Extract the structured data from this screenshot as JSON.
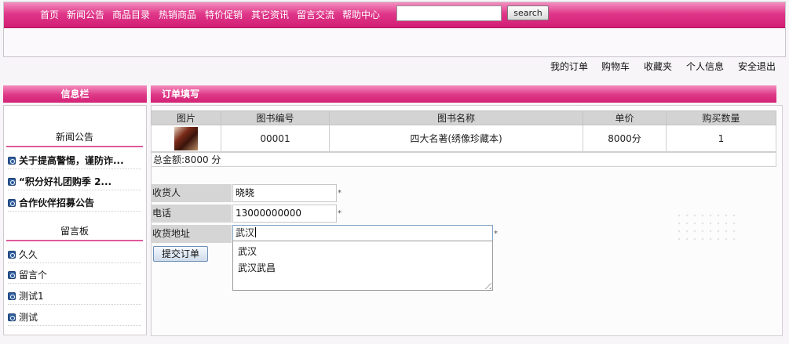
{
  "nav": {
    "items": [
      "首页",
      "新闻公告",
      "商品目录",
      "热销商品",
      "特价促销",
      "其它资讯",
      "留言交流",
      "帮助中心"
    ],
    "search_placeholder": "",
    "search_label": "search"
  },
  "user_links": [
    "我的订单",
    "购物车",
    "收藏夹",
    "个人信息",
    "安全退出"
  ],
  "sidebar": {
    "title": "信息栏",
    "news_title": "新闻公告",
    "news_items": [
      "关于提高警惕，谨防诈...",
      "“积分好礼团购季 2...",
      "合作伙伴招募公告"
    ],
    "messages_title": "留言板",
    "message_items": [
      "久久",
      "留言个",
      "测试1",
      "测试"
    ]
  },
  "main": {
    "title": "订单填写",
    "table": {
      "headers": [
        "图片",
        "图书编号",
        "图书名称",
        "单价",
        "购买数量"
      ],
      "rows": [
        {
          "id": "00001",
          "name": "四大名著(绣像珍藏本)",
          "price": "8000分",
          "qty": "1"
        }
      ]
    },
    "total": "总金额:8000 分",
    "form": {
      "receiver_label": "收货人",
      "receiver_value": "晓晓",
      "phone_label": "电话",
      "phone_value": "13000000000",
      "address_label": "收货地址",
      "address_value": "武汉",
      "required_mark": "*"
    },
    "autocomplete": [
      "武汉",
      "武汉武昌"
    ],
    "submit_label": "提交订单"
  }
}
